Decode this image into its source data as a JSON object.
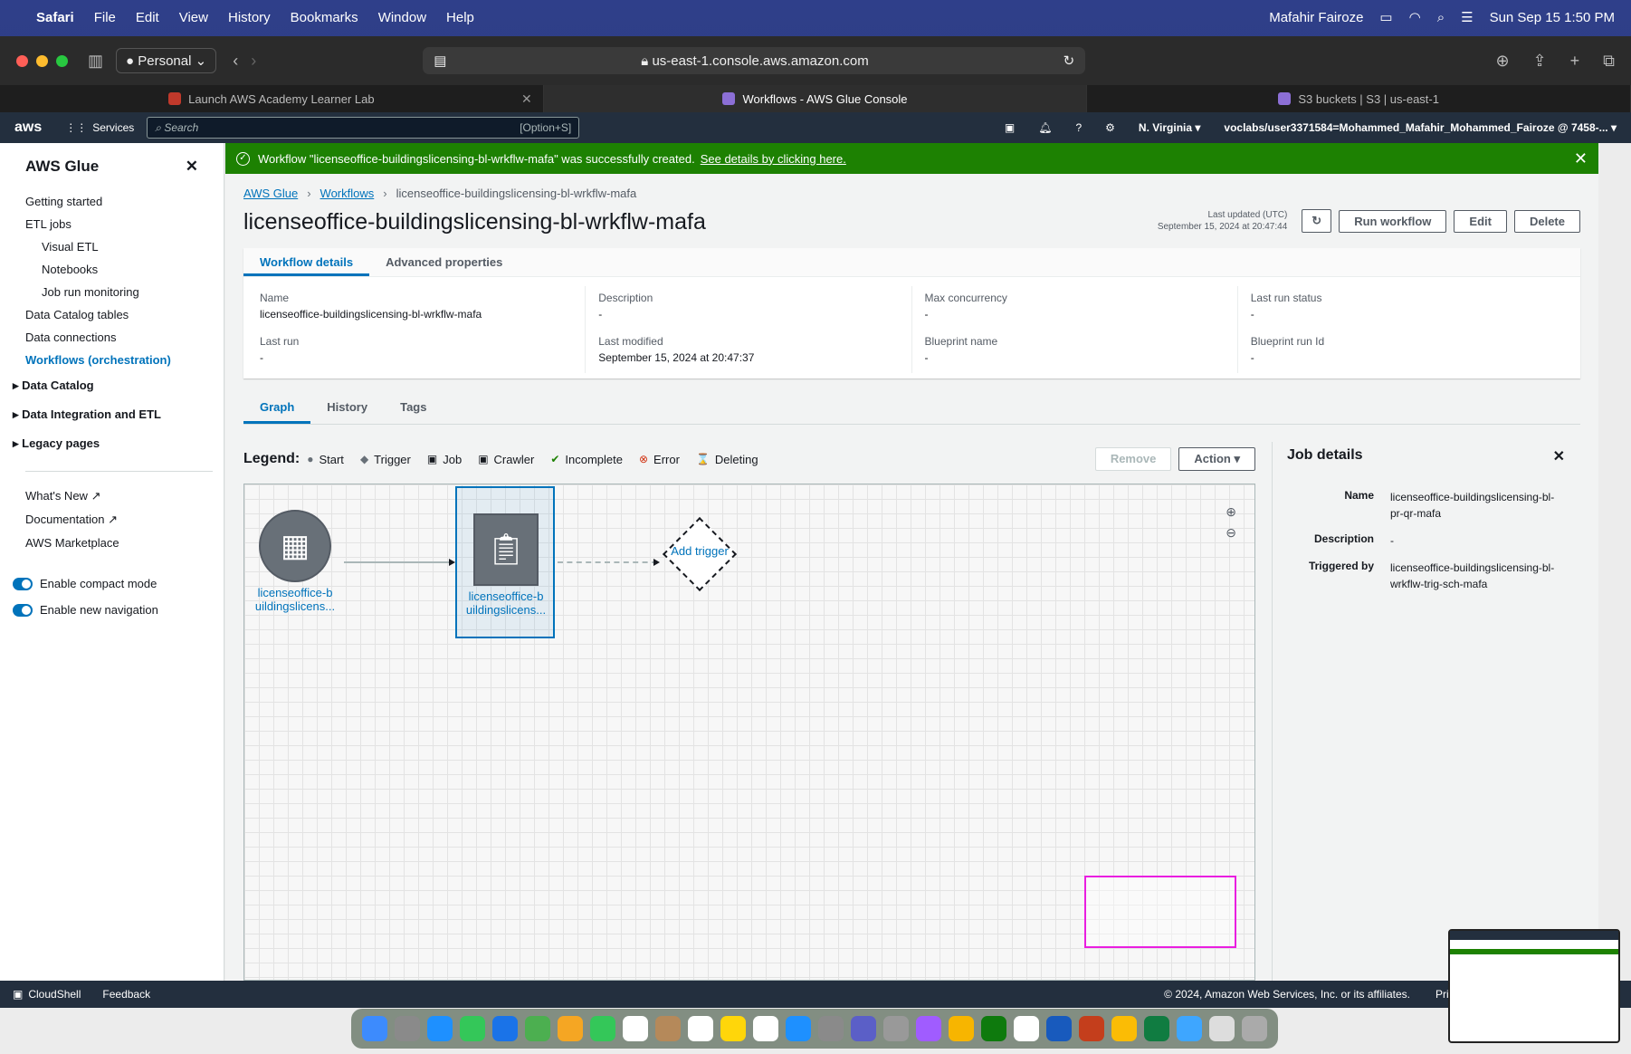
{
  "menubar": {
    "items": [
      "Safari",
      "File",
      "Edit",
      "View",
      "History",
      "Bookmarks",
      "Window",
      "Help"
    ],
    "user": "Mafahir Fairoze",
    "datetime": "Sun Sep 15  1:50 PM"
  },
  "browser": {
    "profile": "Personal",
    "url": "us-east-1.console.aws.amazon.com",
    "tabs": [
      {
        "title": "Launch AWS Academy Learner Lab",
        "active": false
      },
      {
        "title": "Workflows - AWS Glue Console",
        "active": true
      },
      {
        "title": "S3 buckets | S3 | us-east-1",
        "active": false
      }
    ]
  },
  "awsnav": {
    "logo": "aws",
    "services": "Services",
    "search_placeholder": "Search",
    "search_shortcut": "[Option+S]",
    "region": "N. Virginia",
    "account": "voclabs/user3371584=Mohammed_Mafahir_Mohammed_Fairoze @ 7458-..."
  },
  "sidenav": {
    "title": "AWS Glue",
    "items": [
      {
        "label": "Getting started",
        "sub": false
      },
      {
        "label": "ETL jobs",
        "sub": false
      },
      {
        "label": "Visual ETL",
        "sub": true
      },
      {
        "label": "Notebooks",
        "sub": true
      },
      {
        "label": "Job run monitoring",
        "sub": true
      },
      {
        "label": "Data Catalog tables",
        "sub": false
      },
      {
        "label": "Data connections",
        "sub": false
      },
      {
        "label": "Workflows (orchestration)",
        "sub": false
      }
    ],
    "sections": [
      "Data Catalog",
      "Data Integration and ETL",
      "Legacy pages"
    ],
    "links": [
      "What's New",
      "Documentation",
      "AWS Marketplace"
    ],
    "toggles": [
      "Enable compact mode",
      "Enable new navigation"
    ]
  },
  "flash": {
    "message": "Workflow \"licenseoffice-buildingslicensing-bl-wrkflw-mafa\" was successfully created.",
    "link": "See details by clicking here."
  },
  "breadcrumb": [
    "AWS Glue",
    "Workflows",
    "licenseoffice-buildingslicensing-bl-wrkflw-mafa"
  ],
  "page": {
    "title": "licenseoffice-buildingslicensing-bl-wrkflw-mafa",
    "updated_label": "Last updated (UTC)",
    "updated_value": "September 15, 2024 at 20:47:44",
    "buttons": {
      "run": "Run workflow",
      "edit": "Edit",
      "delete": "Delete"
    }
  },
  "details": {
    "tabs": [
      "Workflow details",
      "Advanced properties"
    ],
    "fields": [
      {
        "label": "Name",
        "value": "licenseoffice-buildingslicensing-bl-wrkflw-mafa"
      },
      {
        "label": "Description",
        "value": "-"
      },
      {
        "label": "Max concurrency",
        "value": "-"
      },
      {
        "label": "Last run status",
        "value": "-"
      },
      {
        "label": "Last run",
        "value": "-"
      },
      {
        "label": "Last modified",
        "value": "September 15, 2024 at 20:47:37"
      },
      {
        "label": "Blueprint name",
        "value": "-"
      },
      {
        "label": "Blueprint run Id",
        "value": "-"
      }
    ]
  },
  "graph": {
    "tabs": [
      "Graph",
      "History",
      "Tags"
    ],
    "legend_title": "Legend:",
    "legend": [
      "Start",
      "Trigger",
      "Job",
      "Crawler",
      "Incomplete",
      "Error",
      "Deleting"
    ],
    "remove": "Remove",
    "action": "Action",
    "nodes": {
      "start_label": "licenseoffice-b uildingslicens...",
      "job_label": "licenseoffice-b uildingslicens...",
      "trigger_label": "Add trigger"
    }
  },
  "job_details": {
    "title": "Job details",
    "rows": [
      {
        "k": "Name",
        "v": "licenseoffice-buildingslicensing-bl-pr-qr-mafa"
      },
      {
        "k": "Description",
        "v": "-"
      },
      {
        "k": "Triggered by",
        "v": "licenseoffice-buildingslicensing-bl-wrkflw-trig-sch-mafa"
      }
    ]
  },
  "footer": {
    "cloudshell": "CloudShell",
    "feedback": "Feedback",
    "copyright": "© 2024, Amazon Web Services, Inc. or its affiliates.",
    "privacy": "Pri"
  },
  "colors": {
    "accent": "#0073bb",
    "success": "#1d8102",
    "aws_nav": "#232f3e"
  }
}
